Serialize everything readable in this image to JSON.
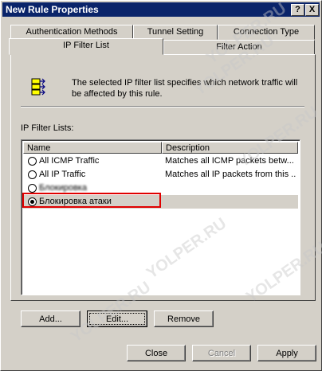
{
  "window": {
    "title": "New Rule Properties",
    "help_button": "?",
    "close_button": "X"
  },
  "tabs": {
    "row1": [
      "Authentication Methods",
      "Tunnel Setting",
      "Connection Type"
    ],
    "row2": [
      "IP Filter List",
      "Filter Action"
    ],
    "active": "IP Filter List"
  },
  "info": {
    "icon": "filter-list-icon",
    "text": "The selected IP filter list specifies which network traffic will be affected by this rule."
  },
  "list": {
    "label": "IP Filter Lists:",
    "columns": [
      "Name",
      "Description"
    ],
    "rows": [
      {
        "name": "All ICMP Traffic",
        "description": "Matches all ICMP packets betw...",
        "selected": false
      },
      {
        "name": "All IP Traffic",
        "description": "Matches all IP packets from this ...",
        "selected": false
      },
      {
        "name": "Блокировка",
        "description": "",
        "selected": false
      },
      {
        "name": "Блокировка атаки",
        "description": "",
        "selected": true
      }
    ]
  },
  "buttons": {
    "add": "Add...",
    "edit": "Edit...",
    "remove": "Remove",
    "close": "Close",
    "cancel": "Cancel",
    "apply": "Apply"
  },
  "watermark": "YOLPER.RU",
  "colors": {
    "titlebar": "#0a246a",
    "face": "#d4d0c8",
    "highlight_box": "#e00000"
  }
}
